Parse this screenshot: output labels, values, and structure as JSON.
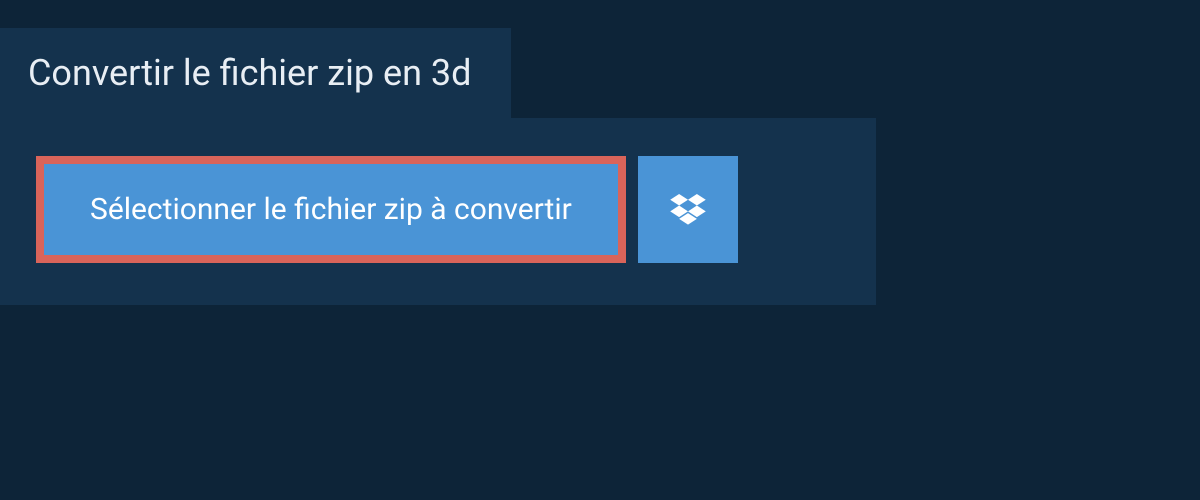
{
  "header": {
    "title": "Convertir le fichier zip en 3d"
  },
  "upload": {
    "select_button_label": "Sélectionner le fichier zip à convertir"
  }
}
